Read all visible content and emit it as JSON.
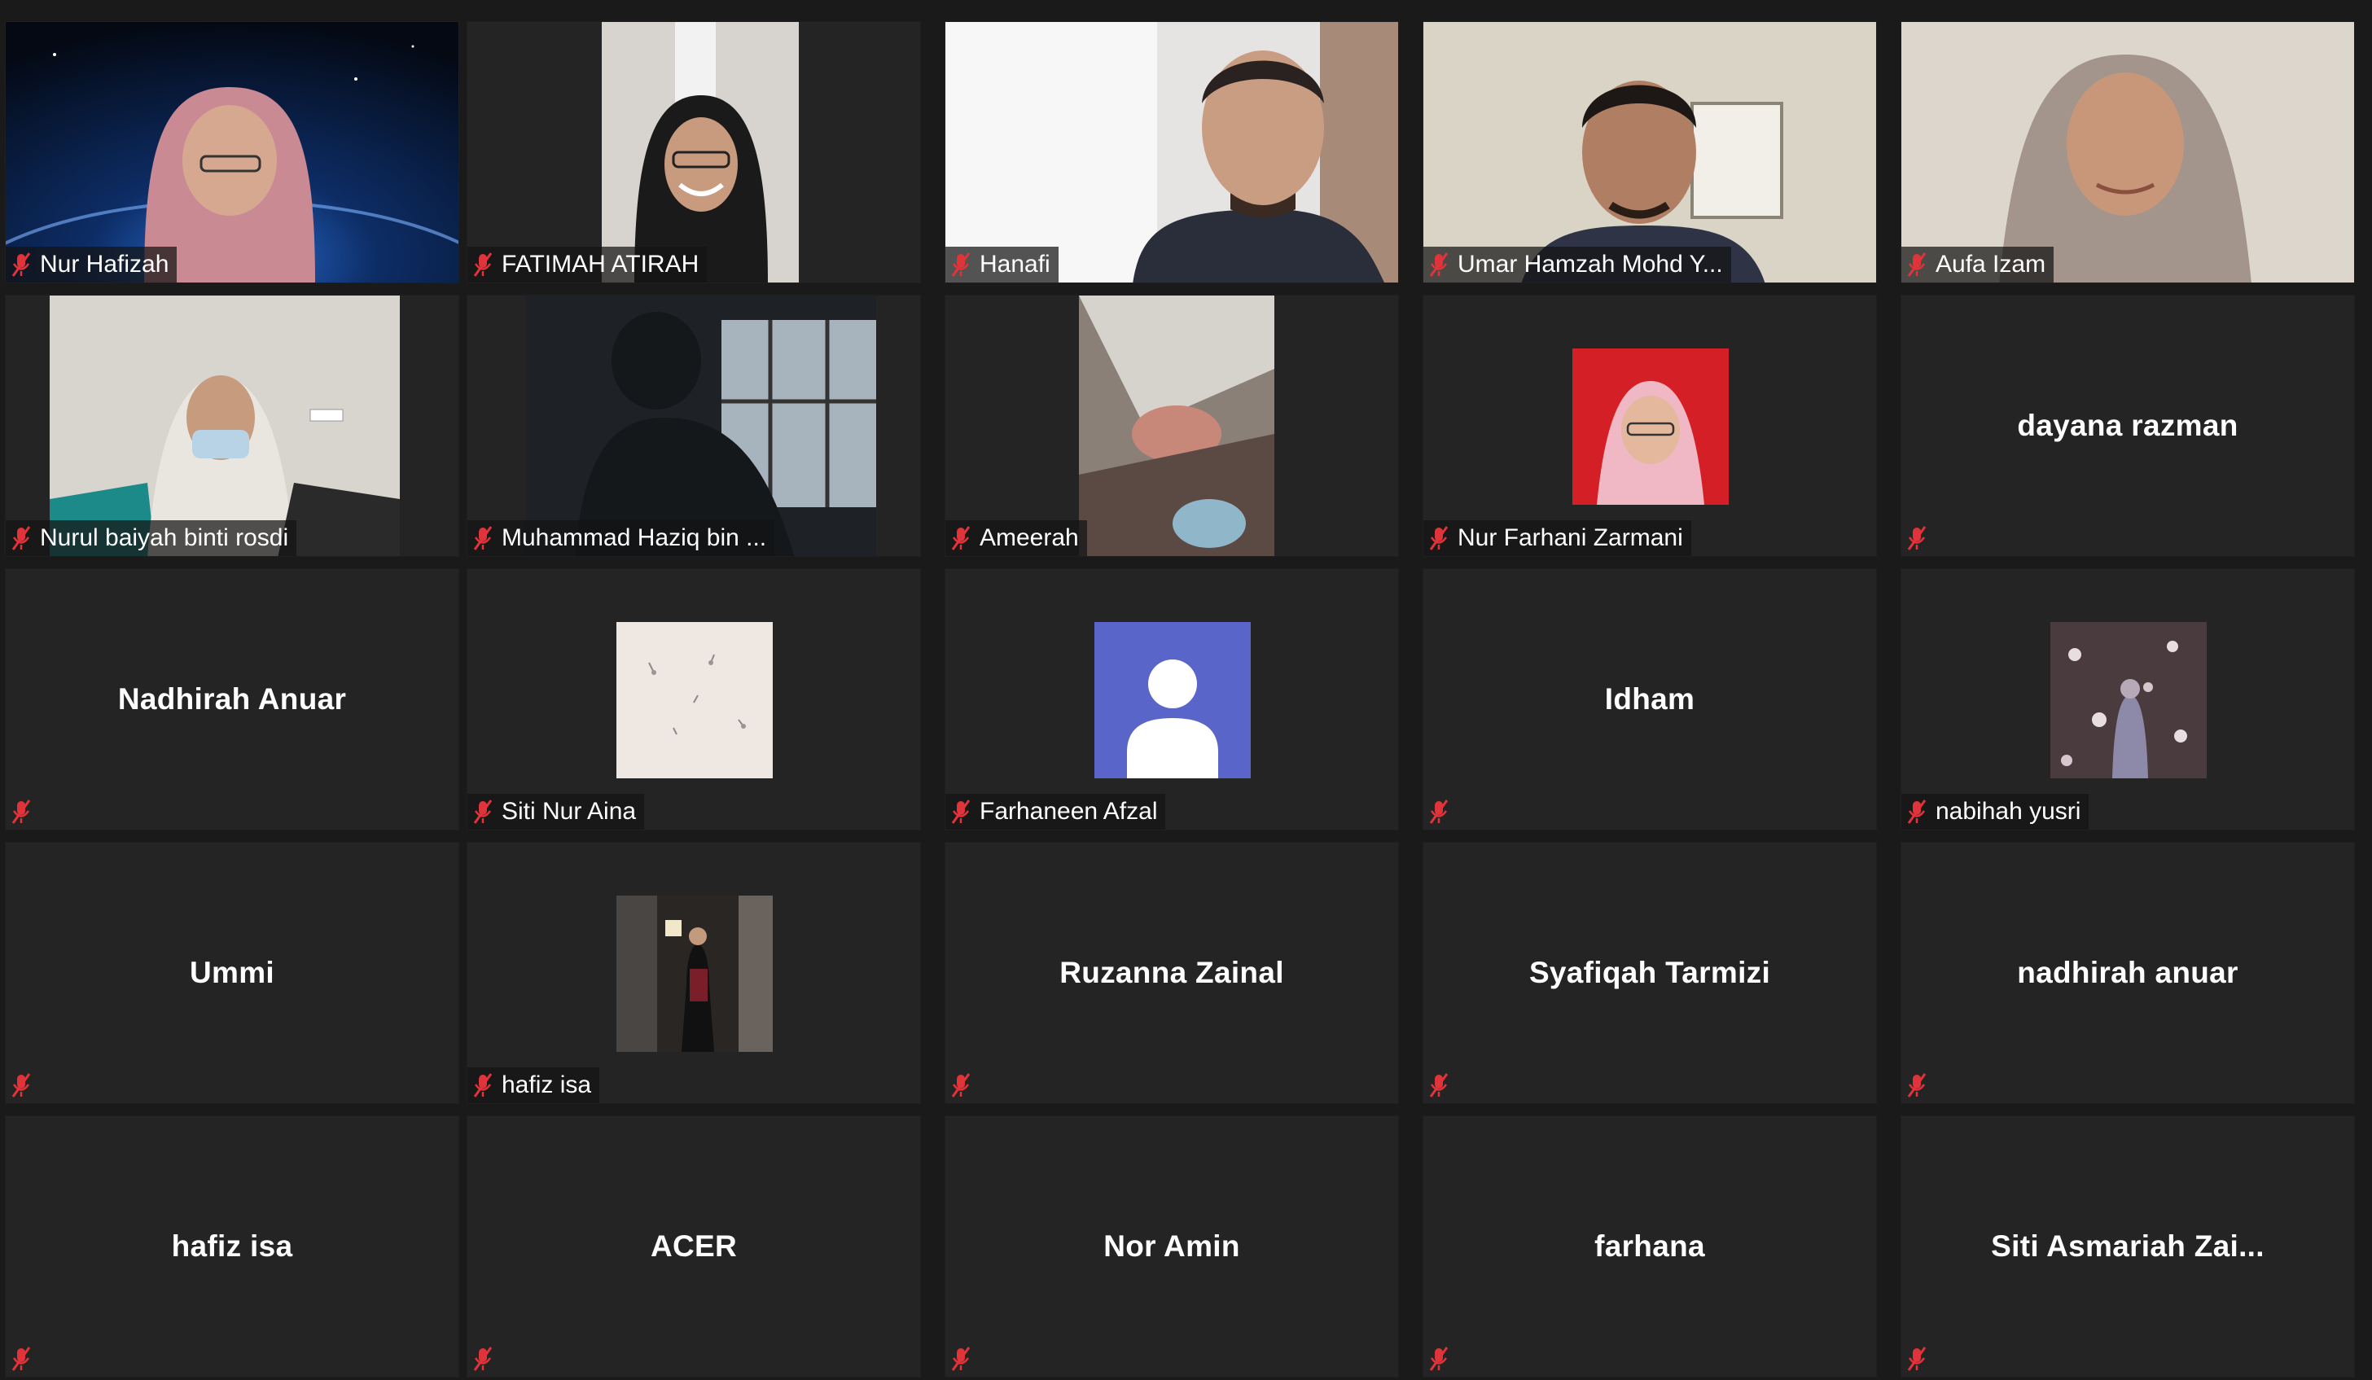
{
  "colors": {
    "background": "#1a1a1a",
    "tile": "#242424",
    "muted_mic": "#e0333a",
    "default_avatar": "#5965c9",
    "name_text": "#ffffff"
  },
  "participants": [
    {
      "name": "Nur Hafizah",
      "mode": "video"
    },
    {
      "name": "FATIMAH ATIRAH",
      "mode": "video"
    },
    {
      "name": "Hanafi",
      "mode": "video"
    },
    {
      "name": "Umar Hamzah Mohd Y...",
      "mode": "video"
    },
    {
      "name": "Aufa Izam",
      "mode": "video"
    },
    {
      "name": "Nurul baiyah binti rosdi",
      "mode": "video"
    },
    {
      "name": "Muhammad Haziq bin ...",
      "mode": "video"
    },
    {
      "name": "Ameerah",
      "mode": "video"
    },
    {
      "name": "Nur Farhani Zarmani",
      "mode": "photo"
    },
    {
      "name": "dayana razman",
      "mode": "name-only"
    },
    {
      "name": "Nadhirah Anuar",
      "mode": "name-only"
    },
    {
      "name": "Siti Nur Aina",
      "mode": "photo"
    },
    {
      "name": "Farhaneen Afzal",
      "mode": "default-avatar"
    },
    {
      "name": "Idham",
      "mode": "name-only"
    },
    {
      "name": "nabihah yusri",
      "mode": "photo"
    },
    {
      "name": "Ummi",
      "mode": "name-only"
    },
    {
      "name": "hafiz isa",
      "mode": "photo"
    },
    {
      "name": "Ruzanna Zainal",
      "mode": "name-only"
    },
    {
      "name": "Syafiqah Tarmizi",
      "mode": "name-only"
    },
    {
      "name": "nadhirah anuar",
      "mode": "name-only"
    },
    {
      "name": "hafiz isa",
      "mode": "name-only"
    },
    {
      "name": "ACER",
      "mode": "name-only"
    },
    {
      "name": "Nor Amin",
      "mode": "name-only"
    },
    {
      "name": "farhana",
      "mode": "name-only"
    },
    {
      "name": "Siti Asmariah Zai...",
      "mode": "name-only"
    }
  ],
  "icons": {
    "muted": "mic-muted-icon",
    "default_avatar": "person-silhouette-icon"
  }
}
